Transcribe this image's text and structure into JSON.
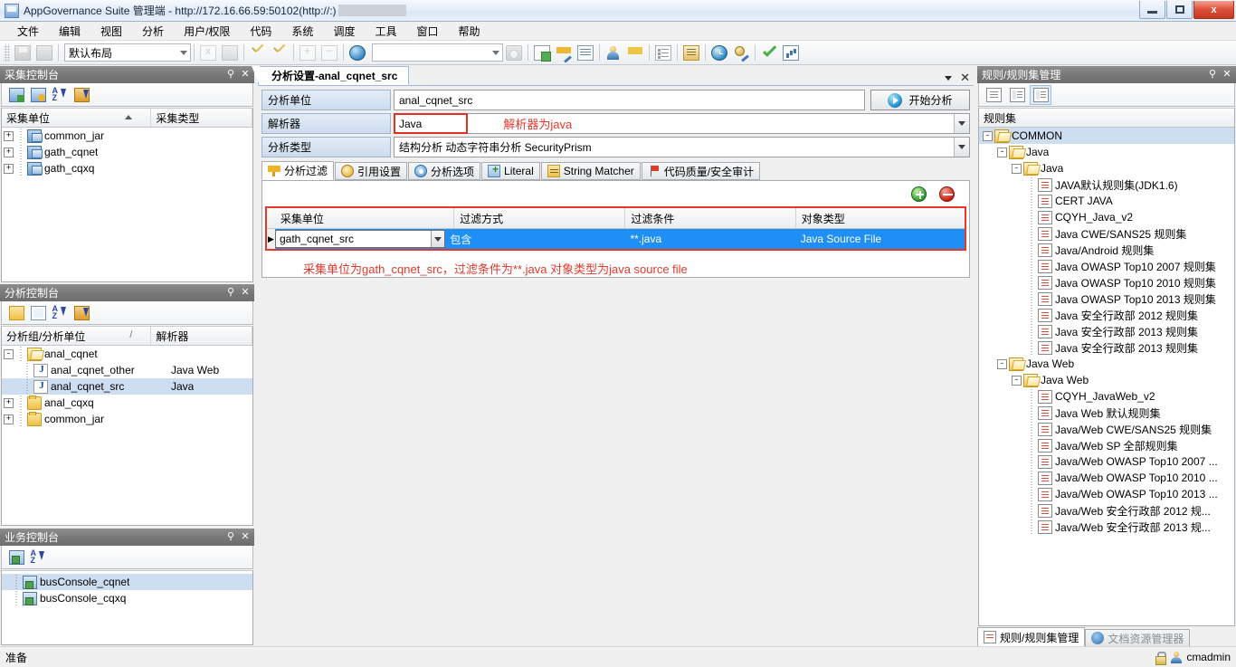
{
  "window": {
    "title": "AppGovernance Suite 管理端 - http://172.16.66.59:50102(http://:)",
    "minimize_label": "",
    "maximize_label": "",
    "close_label": "x"
  },
  "menubar": {
    "items": [
      {
        "label": "文件"
      },
      {
        "label": "编辑"
      },
      {
        "label": "视图"
      },
      {
        "label": "分析"
      },
      {
        "label": "用户/权限"
      },
      {
        "label": "代码"
      },
      {
        "label": "系统"
      },
      {
        "label": "调度"
      },
      {
        "label": "工具"
      },
      {
        "label": "窗口"
      },
      {
        "label": "帮助"
      }
    ]
  },
  "toolbar": {
    "layout_combo_value": "默认布局",
    "search_combo_value": "",
    "icons": [
      "save-icon",
      "print-icon",
      "close-doc-icon",
      "delete-doc-icon",
      "check-yellow-icon",
      "check-yellow-2-icon",
      "expand-all-icon",
      "collapse-all-icon",
      "globe-icon",
      "camera-icon",
      "new-doc-icon",
      "edit-filter-icon",
      "table-icon",
      "user-icon",
      "badge-edit-icon",
      "list-icon",
      "news-icon",
      "clock-icon",
      "medal-edit-icon",
      "approve-check-icon",
      "chart-icon"
    ]
  },
  "gather_console": {
    "title": "采集控制台",
    "tools": [
      "add-gather-icon",
      "refresh-gather-icon",
      "sort-az-icon",
      "group-sort-icon"
    ],
    "columns": [
      "采集单位",
      "采集类型"
    ],
    "rows": [
      {
        "name": "common_jar",
        "type": "",
        "expander": "+",
        "selected": false
      },
      {
        "name": "gath_cqnet",
        "type": "",
        "expander": "+",
        "selected": false
      },
      {
        "name": "gath_cqxq",
        "type": "",
        "expander": "+",
        "selected": false
      }
    ]
  },
  "analysis_console": {
    "title": "分析控制台",
    "tools": [
      "folder-icon",
      "new-page-icon",
      "sort-az-icon",
      "group-sort-icon"
    ],
    "columns": [
      "分析组/分析单位",
      "解析器"
    ],
    "rows": [
      {
        "name": "anal_cqnet",
        "parser": "",
        "expander": "-",
        "indent": 0,
        "icon": "folder-open-icon",
        "selected": false
      },
      {
        "name": "anal_cqnet_other",
        "parser": "Java Web",
        "expander": "",
        "indent": 1,
        "icon": "java-unit-icon",
        "selected": false
      },
      {
        "name": "anal_cqnet_src",
        "parser": "Java",
        "expander": "",
        "indent": 1,
        "icon": "java-unit-icon",
        "selected": true
      },
      {
        "name": "anal_cqxq",
        "parser": "",
        "expander": "+",
        "indent": 0,
        "icon": "folder-icon",
        "selected": false
      },
      {
        "name": "common_jar",
        "parser": "",
        "expander": "+",
        "indent": 0,
        "icon": "folder-icon",
        "selected": false
      }
    ]
  },
  "business_console": {
    "title": "业务控制台",
    "tools": [
      "bus-console-icon",
      "sort-az-icon"
    ],
    "rows": [
      {
        "name": "busConsole_cqnet",
        "selected": true
      },
      {
        "name": "busConsole_cqxq",
        "selected": false
      }
    ]
  },
  "editor": {
    "tab_label": "分析设置-anal_cqnet_src",
    "tab_menu_icon": "chevron-down-icon",
    "tab_close_icon": "close-icon",
    "fields": [
      {
        "label": "分析单位",
        "value": "anal_cqnet_src",
        "kind": "text"
      },
      {
        "label": "解析器",
        "value": "Java",
        "kind": "combo",
        "highlighted": true,
        "note": "解析器为java"
      },
      {
        "label": "分析类型",
        "value": "结构分析 动态字符串分析 SecurityPrism",
        "kind": "combo"
      }
    ],
    "start_button_label": "开始分析",
    "start_button_icon": "play-icon",
    "inner_tabs": [
      {
        "label": "分析过滤",
        "icon": "funnel-icon",
        "active": true
      },
      {
        "label": "引用设置",
        "icon": "reference-icon",
        "active": false
      },
      {
        "label": "分析选项",
        "icon": "gear-icon",
        "active": false
      },
      {
        "label": "Literal",
        "icon": "literal-icon",
        "active": false
      },
      {
        "label": "String Matcher",
        "icon": "string-matcher-icon",
        "active": false
      },
      {
        "label": "代码质量/安全审计",
        "icon": "flag-icon",
        "active": false
      }
    ],
    "filter_panel": {
      "add_icon": "add-row-icon",
      "remove_icon": "remove-row-icon",
      "columns": [
        "采集单位",
        "过滤方式",
        "过滤条件",
        "对象类型"
      ],
      "rows": [
        {
          "gather_unit": "gath_cqnet_src",
          "filter_mode": "包含",
          "filter_condition": "**.java",
          "object_type": "Java Source File",
          "selected": true
        }
      ],
      "annotation": "采集单位为gath_cqnet_src，过滤条件为**.java 对象类型为java source file",
      "highlight_color": "#e8372a"
    }
  },
  "rule_panel": {
    "title": "规则/规则集管理",
    "tools": [
      "rule-list-icon",
      "rule-copy-icon",
      "rule-edit-icon"
    ],
    "header": "规则集",
    "tree": [
      {
        "label": "COMMON",
        "depth": 0,
        "expander": "-",
        "icon": "folder-open-icon",
        "selected": true
      },
      {
        "label": "Java",
        "depth": 1,
        "expander": "-",
        "icon": "folder-open-icon",
        "selected": false
      },
      {
        "label": "Java",
        "depth": 2,
        "expander": "-",
        "icon": "folder-open-icon",
        "selected": false
      },
      {
        "label": "JAVA默认规则集(JDK1.6)",
        "depth": 3,
        "expander": "",
        "icon": "rule-icon",
        "selected": false
      },
      {
        "label": "CERT JAVA",
        "depth": 3,
        "expander": "",
        "icon": "rule-icon",
        "selected": false
      },
      {
        "label": "CQYH_Java_v2",
        "depth": 3,
        "expander": "",
        "icon": "rule-icon",
        "selected": false
      },
      {
        "label": "Java CWE/SANS25 规则集",
        "depth": 3,
        "expander": "",
        "icon": "rule-icon",
        "selected": false
      },
      {
        "label": "Java/Android 规则集",
        "depth": 3,
        "expander": "",
        "icon": "rule-icon",
        "selected": false
      },
      {
        "label": "Java OWASP Top10 2007 规则集",
        "depth": 3,
        "expander": "",
        "icon": "rule-icon",
        "selected": false
      },
      {
        "label": "Java OWASP Top10 2010 规则集",
        "depth": 3,
        "expander": "",
        "icon": "rule-icon",
        "selected": false
      },
      {
        "label": "Java OWASP Top10 2013 规则集",
        "depth": 3,
        "expander": "",
        "icon": "rule-icon",
        "selected": false
      },
      {
        "label": "Java 安全行政部 2012 规则集",
        "depth": 3,
        "expander": "",
        "icon": "rule-icon",
        "selected": false
      },
      {
        "label": "Java 安全行政部 2013 规则集",
        "depth": 3,
        "expander": "",
        "icon": "rule-icon",
        "selected": false
      },
      {
        "label": "Java 安全行政部 2013 规则集",
        "depth": 3,
        "expander": "",
        "icon": "rule-icon",
        "selected": false
      },
      {
        "label": "Java Web",
        "depth": 1,
        "expander": "-",
        "icon": "folder-open-icon",
        "selected": false
      },
      {
        "label": "Java Web",
        "depth": 2,
        "expander": "-",
        "icon": "folder-open-icon",
        "selected": false
      },
      {
        "label": "CQYH_JavaWeb_v2",
        "depth": 3,
        "expander": "",
        "icon": "rule-icon",
        "selected": false
      },
      {
        "label": "Java Web 默认规则集",
        "depth": 3,
        "expander": "",
        "icon": "rule-icon",
        "selected": false
      },
      {
        "label": "Java/Web CWE/SANS25 规则集",
        "depth": 3,
        "expander": "",
        "icon": "rule-icon",
        "selected": false
      },
      {
        "label": "Java/Web SP 全部规则集",
        "depth": 3,
        "expander": "",
        "icon": "rule-icon",
        "selected": false
      },
      {
        "label": "Java/Web OWASP Top10 2007 ...",
        "depth": 3,
        "expander": "",
        "icon": "rule-icon",
        "selected": false
      },
      {
        "label": "Java/Web OWASP Top10 2010 ...",
        "depth": 3,
        "expander": "",
        "icon": "rule-icon",
        "selected": false
      },
      {
        "label": "Java/Web OWASP Top10 2013 ...",
        "depth": 3,
        "expander": "",
        "icon": "rule-icon",
        "selected": false
      },
      {
        "label": "Java/Web 安全行政部 2012 规...",
        "depth": 3,
        "expander": "",
        "icon": "rule-icon",
        "selected": false
      },
      {
        "label": "Java/Web 安全行政部 2013 规...",
        "depth": 3,
        "expander": "",
        "icon": "rule-icon",
        "selected": false
      }
    ]
  },
  "bottom_tabs": [
    {
      "label": "规则/规则集管理",
      "icon": "rule-mgmt-icon",
      "active": true
    },
    {
      "label": "文档资源管理器",
      "icon": "doc-explorer-icon",
      "active": false
    }
  ],
  "statusbar": {
    "status_text": "准备",
    "user": "cmadmin",
    "lock_icon": "lock-icon",
    "user_icon": "user-icon"
  }
}
